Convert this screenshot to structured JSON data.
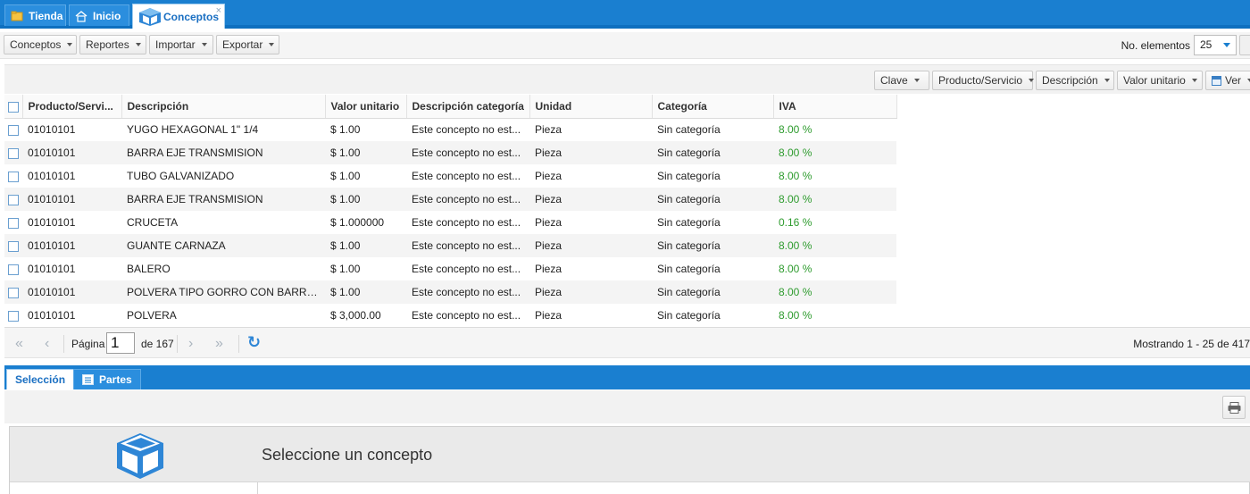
{
  "top_tabs": [
    {
      "label": "Tienda",
      "icon": "folder-icon",
      "active": false
    },
    {
      "label": "Inicio",
      "icon": "home-icon",
      "active": false
    },
    {
      "label": "Conceptos",
      "icon": "box-icon",
      "active": true,
      "close": "×"
    }
  ],
  "toolbar": {
    "menus": [
      "Conceptos",
      "Reportes",
      "Importar",
      "Exportar"
    ],
    "items_label": "No. elementos",
    "items_value": "25"
  },
  "filters": {
    "buttons": [
      "Clave",
      "Producto/Servicio",
      "Descripción",
      "Valor unitario"
    ],
    "view_label": "Ver"
  },
  "grid": {
    "columns": [
      "Producto/Servi...",
      "Descripción",
      "Valor unitario",
      "Descripción categoría",
      "Unidad",
      "Categoría",
      "IVA"
    ],
    "rows": [
      [
        "01010101",
        "YUGO HEXAGONAL 1\" 1/4",
        "$ 1.00",
        "Este concepto no est...",
        "Pieza",
        "Sin categoría",
        "8.00 %"
      ],
      [
        "01010101",
        "BARRA EJE TRANSMISION",
        "$ 1.00",
        "Este concepto no est...",
        "Pieza",
        "Sin categoría",
        "8.00 %"
      ],
      [
        "01010101",
        "TUBO GALVANIZADO",
        "$ 1.00",
        "Este concepto no est...",
        "Pieza",
        "Sin categoría",
        "8.00 %"
      ],
      [
        "01010101",
        "BARRA EJE TRANSMISION",
        "$ 1.00",
        "Este concepto no est...",
        "Pieza",
        "Sin categoría",
        "8.00 %"
      ],
      [
        "01010101",
        "CRUCETA",
        "$ 1.000000",
        "Este concepto no est...",
        "Pieza",
        "Sin categoría",
        "0.16 %"
      ],
      [
        "01010101",
        "GUANTE CARNAZA",
        "$ 1.00",
        "Este concepto no est...",
        "Pieza",
        "Sin categoría",
        "8.00 %"
      ],
      [
        "01010101",
        "BALERO",
        "$ 1.00",
        "Este concepto no est...",
        "Pieza",
        "Sin categoría",
        "8.00 %"
      ],
      [
        "01010101",
        "POLVERA TIPO GORRO CON BARRE...",
        "$ 1.00",
        "Este concepto no est...",
        "Pieza",
        "Sin categoría",
        "8.00 %"
      ],
      [
        "01010101",
        "POLVERA",
        "$ 3,000.00",
        "Este concepto no est...",
        "Pieza",
        "Sin categoría",
        "8.00 %"
      ]
    ]
  },
  "pager": {
    "first": "«",
    "prev": "‹",
    "page_label": "Página",
    "page_value": "1",
    "total_label": "de 167",
    "next": "›",
    "last": "»",
    "refresh": "↻",
    "showing": "Mostrando 1 - 25 de 417"
  },
  "bottom_tabs": [
    {
      "label": "Selección",
      "active": true
    },
    {
      "label": "Partes",
      "icon": "list-icon",
      "active": false
    }
  ],
  "detail": {
    "title": "Seleccione un concepto"
  },
  "colors": {
    "brand_blue": "#1a7fd0",
    "iva_green": "#2d9b2d"
  }
}
